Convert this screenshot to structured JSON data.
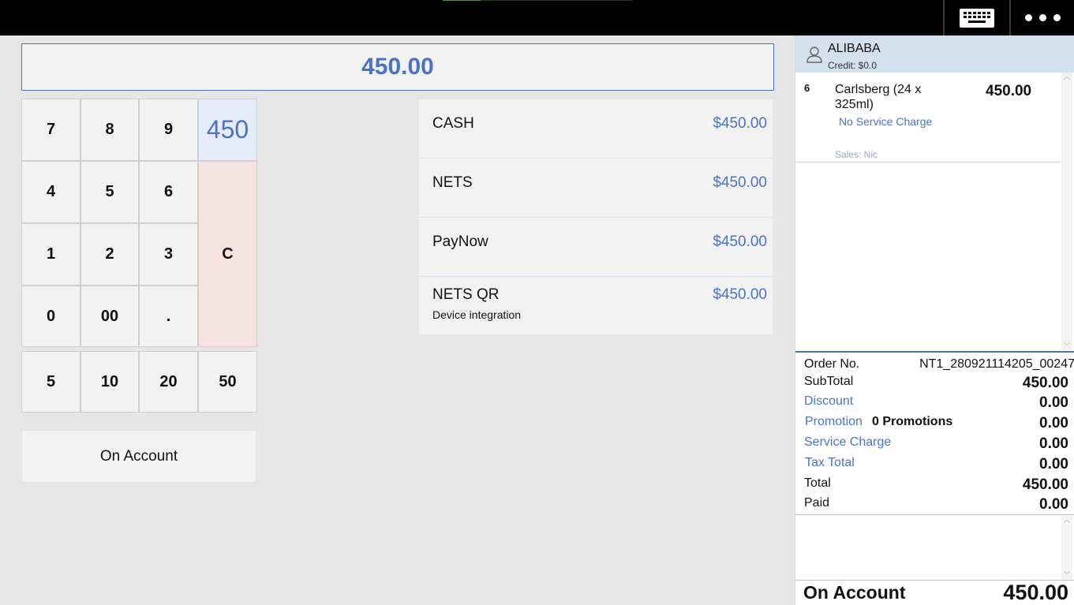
{
  "topbar": {
    "keyboard_icon": "keyboard-icon",
    "more_icon": "more-dots-icon"
  },
  "display": {
    "amount": "450.00"
  },
  "keypad": {
    "keys": [
      "7",
      "8",
      "9",
      "4",
      "5",
      "6",
      "1",
      "2",
      "3",
      "0",
      "00",
      "."
    ],
    "entry_value": "450",
    "clear_label": "C",
    "quick_amounts": [
      "5",
      "10",
      "20",
      "50"
    ]
  },
  "on_account_button": "On Account",
  "payment_methods": [
    {
      "name": "CASH",
      "amount": "$450.00",
      "subtitle": ""
    },
    {
      "name": "NETS",
      "amount": "$450.00",
      "subtitle": ""
    },
    {
      "name": "PayNow",
      "amount": "$450.00",
      "subtitle": ""
    },
    {
      "name": "NETS QR",
      "amount": "$450.00",
      "subtitle": "Device integration"
    }
  ],
  "customer": {
    "name": "ALIBABA",
    "credit": "Credit: $0.0",
    "icon": "person-icon"
  },
  "order_items": [
    {
      "qty": "6",
      "name": "Carlsberg (24 x 325ml)",
      "price": "450.00",
      "service_note": "No Service Charge",
      "sales": "Sales: Nic"
    }
  ],
  "totals": {
    "order_no_label": "Order No.",
    "order_no": "NT1_280921114205_00247",
    "subtotal_label": "SubTotal",
    "subtotal": "450.00",
    "discount_label": "Discount",
    "discount": "0.00",
    "promotion_label": "Promotion",
    "promotion_count": "0 Promotions",
    "promotion": "0.00",
    "service_charge_label": "Service Charge",
    "service_charge": "0.00",
    "tax_total_label": "Tax Total",
    "tax_total": "0.00",
    "total_label": "Total",
    "total": "450.00",
    "paid_label": "Paid",
    "paid": "0.00"
  },
  "summary": {
    "label": "On Account",
    "amount": "450.00"
  },
  "colors": {
    "accent": "#4a72c9",
    "clear_key": "#f7e2e2",
    "entry_key": "#e5ecf7",
    "customer_bar": "#d5e0ef"
  }
}
